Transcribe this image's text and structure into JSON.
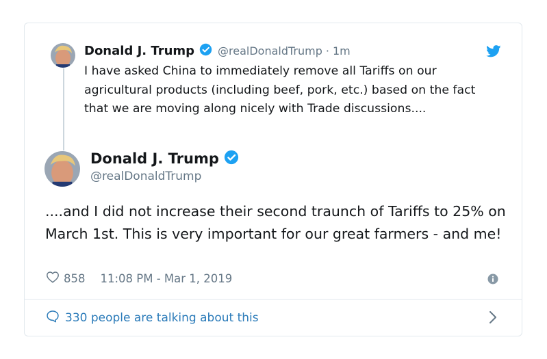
{
  "parent_tweet": {
    "name": "Donald J. Trump",
    "handle": "@realDonaldTrump",
    "separator": "·",
    "time": "1m",
    "text": "I have asked China to immediately remove all Tariffs on our agricultural products (including beef, pork, etc.) based on the fact that we are moving along nicely with Trade discussions...."
  },
  "main_tweet": {
    "name": "Donald J. Trump",
    "handle": "@realDonaldTrump",
    "text": "....and I did not increase their second traunch of Tariffs to 25% on March 1st. This is very important for our great farmers - and me!",
    "likes": "858",
    "timestamp": "11:08 PM - Mar 1, 2019"
  },
  "conversation": {
    "label": "330 people are talking about this"
  },
  "colors": {
    "twitter_blue": "#1da1f2",
    "link_blue": "#2b7bb9",
    "muted": "#657786",
    "text": "#14171a",
    "border": "#e1e8ed"
  },
  "icons": [
    "verified-badge-icon",
    "twitter-bird-icon",
    "heart-icon",
    "info-icon",
    "speech-bubble-icon",
    "chevron-right-icon"
  ]
}
